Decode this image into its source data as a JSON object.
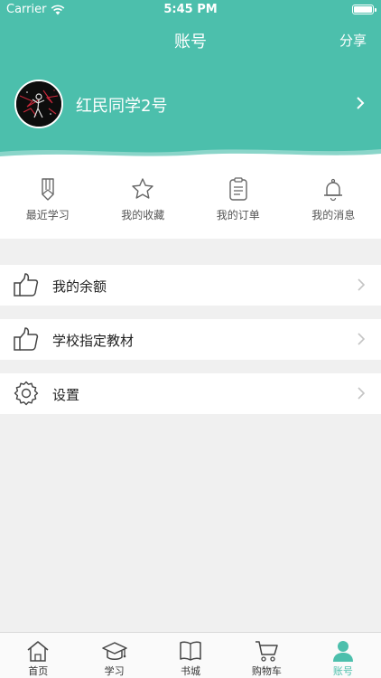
{
  "status_bar": {
    "carrier": "Carrier",
    "time": "5:45 PM"
  },
  "nav": {
    "title": "账号",
    "share_label": "分享"
  },
  "profile": {
    "username": "红民同学2号"
  },
  "quick_actions": [
    {
      "label": "最近学习",
      "icon": "pencil-icon"
    },
    {
      "label": "我的收藏",
      "icon": "star-icon"
    },
    {
      "label": "我的订单",
      "icon": "clipboard-icon"
    },
    {
      "label": "我的消息",
      "icon": "bell-icon"
    }
  ],
  "menu": [
    {
      "label": "我的余额",
      "icon": "thumbs-up-icon"
    },
    {
      "label": "学校指定教材",
      "icon": "thumbs-up-icon"
    },
    {
      "label": "设置",
      "icon": "gear-icon"
    }
  ],
  "tabbar": {
    "tabs": [
      {
        "label": "首页",
        "icon": "home-icon"
      },
      {
        "label": "学习",
        "icon": "graduation-cap-icon"
      },
      {
        "label": "书城",
        "icon": "book-icon"
      },
      {
        "label": "购物车",
        "icon": "cart-icon"
      },
      {
        "label": "账号",
        "icon": "user-icon"
      }
    ],
    "active_index": 4
  },
  "colors": {
    "accent": "#4cbfac",
    "background": "#f0f0f0"
  }
}
